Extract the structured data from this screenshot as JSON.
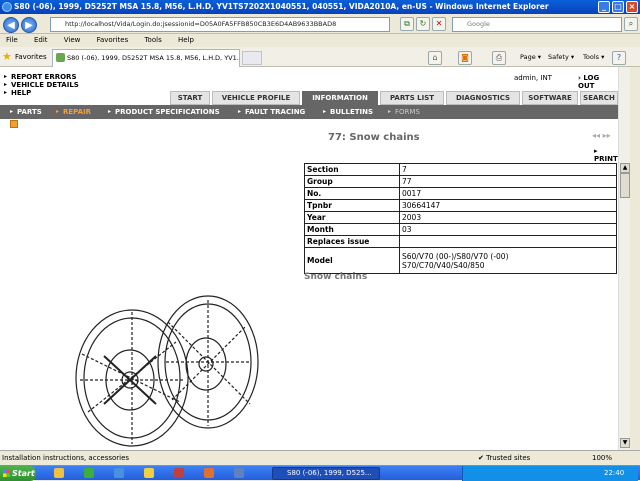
{
  "window": {
    "title": "S80 (-06), 1999, D5252T MSA 15.8, M56, L.H.D, YV1TS7202X1040551, 040551, VIDA2010A, en-US - Windows Internet Explorer"
  },
  "address_bar": {
    "url": "http://localhost/Vida/Login.do;jsessionid=D05A0FA5FFB850CB3E6D4AB9633BBAD8",
    "search_placeholder": "Google"
  },
  "menu": [
    "File",
    "Edit",
    "View",
    "Favorites",
    "Tools",
    "Help"
  ],
  "favorites_bar": {
    "label": "Favorites",
    "tab_title": "S80 (-06), 1999, D5252T MSA 15.8, M56, L.H.D, YV1...",
    "commands": [
      "Page ▾",
      "Safety ▾",
      "Tools ▾"
    ]
  },
  "app": {
    "side_links": [
      "REPORT ERRORS",
      "VEHICLE DETAILS",
      "HELP"
    ],
    "user": "admin, INT",
    "logout": "LOG OUT",
    "tabs": [
      "START",
      "VEHICLE PROFILE",
      "INFORMATION",
      "PARTS LIST",
      "DIAGNOSTICS",
      "SOFTWARE",
      "SEARCH"
    ],
    "active_tab": "INFORMATION",
    "subnav": [
      "PARTS",
      "REPAIR",
      "PRODUCT SPECIFICATIONS",
      "FAULT TRACING",
      "BULLETINS",
      "FORMS"
    ],
    "active_subnav": "REPAIR"
  },
  "document": {
    "title": "77: Snow chains",
    "print_label": "PRINT",
    "nav_arrows": "◂◂  ▸▸",
    "info_rows": [
      {
        "label": "Section",
        "value": "7"
      },
      {
        "label": "Group",
        "value": "77"
      },
      {
        "label": "No.",
        "value": "0017"
      },
      {
        "label": "Tpnbr",
        "value": "30664147"
      },
      {
        "label": "Year",
        "value": "2003"
      },
      {
        "label": "Month",
        "value": "03"
      },
      {
        "label": "Replaces issue",
        "value": ""
      },
      {
        "label": "Model",
        "value": "S60/V70 (00-)/S80/V70 (-00)\nS70/C70/V40/S40/850"
      }
    ],
    "subtitle": "Snow chains"
  },
  "statusbar": {
    "text": "Installation instructions, accessories",
    "zone": "Trusted sites",
    "zoom": "100%"
  },
  "taskbar": {
    "start": "Start",
    "active_item": "S80 (-06), 1999, D525...",
    "clock": "22:40"
  }
}
